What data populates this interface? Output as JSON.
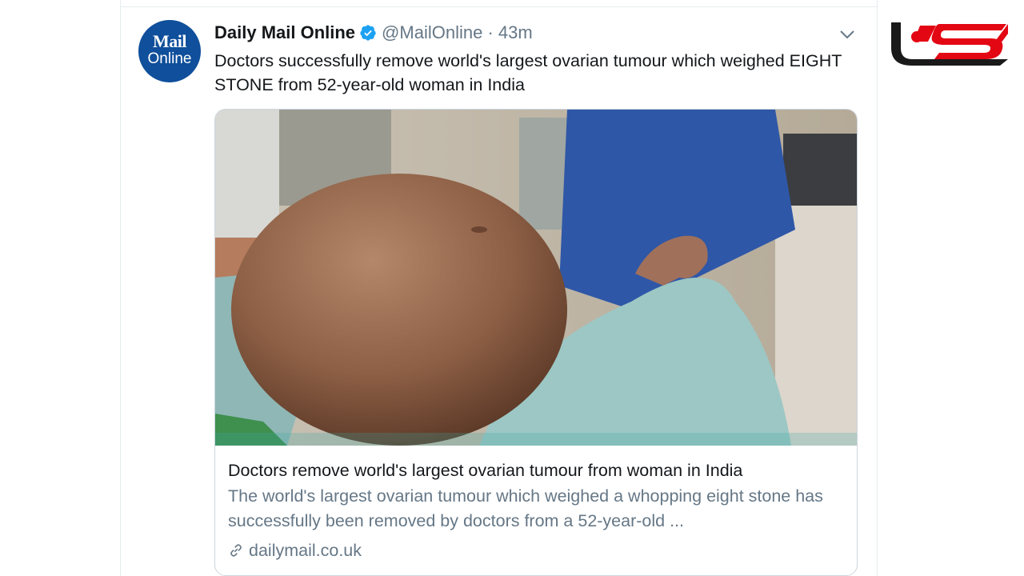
{
  "site_logo": {
    "name": "site-logo",
    "color": "#e30613",
    "dark": "#1a1a1a"
  },
  "tweet": {
    "avatar": {
      "line1": "Mail",
      "line2": "Online",
      "bg": "#0f4f9b"
    },
    "author_name": "Daily Mail Online",
    "handle": "@MailOnline",
    "separator": "·",
    "time": "43m",
    "text": "Doctors successfully remove world's largest ovarian tumour which weighed EIGHT STONE from 52-year-old woman in India",
    "verified_icon": "verified-badge-icon",
    "menu_icon": "chevron-down-icon"
  },
  "card": {
    "image_alt": "photo of patient with large abdominal tumour in operating room",
    "title": "Doctors remove world's largest ovarian tumour from woman in India",
    "description": "The world's largest ovarian tumour which weighed a whopping eight stone has successfully been removed by doctors from a 52-year-old ...",
    "domain": "dailymail.co.uk",
    "link_icon": "link-icon"
  },
  "colors": {
    "accent": "#1da1f2",
    "text": "#14171a",
    "secondary": "#657786",
    "border": "#ccd6dd"
  }
}
